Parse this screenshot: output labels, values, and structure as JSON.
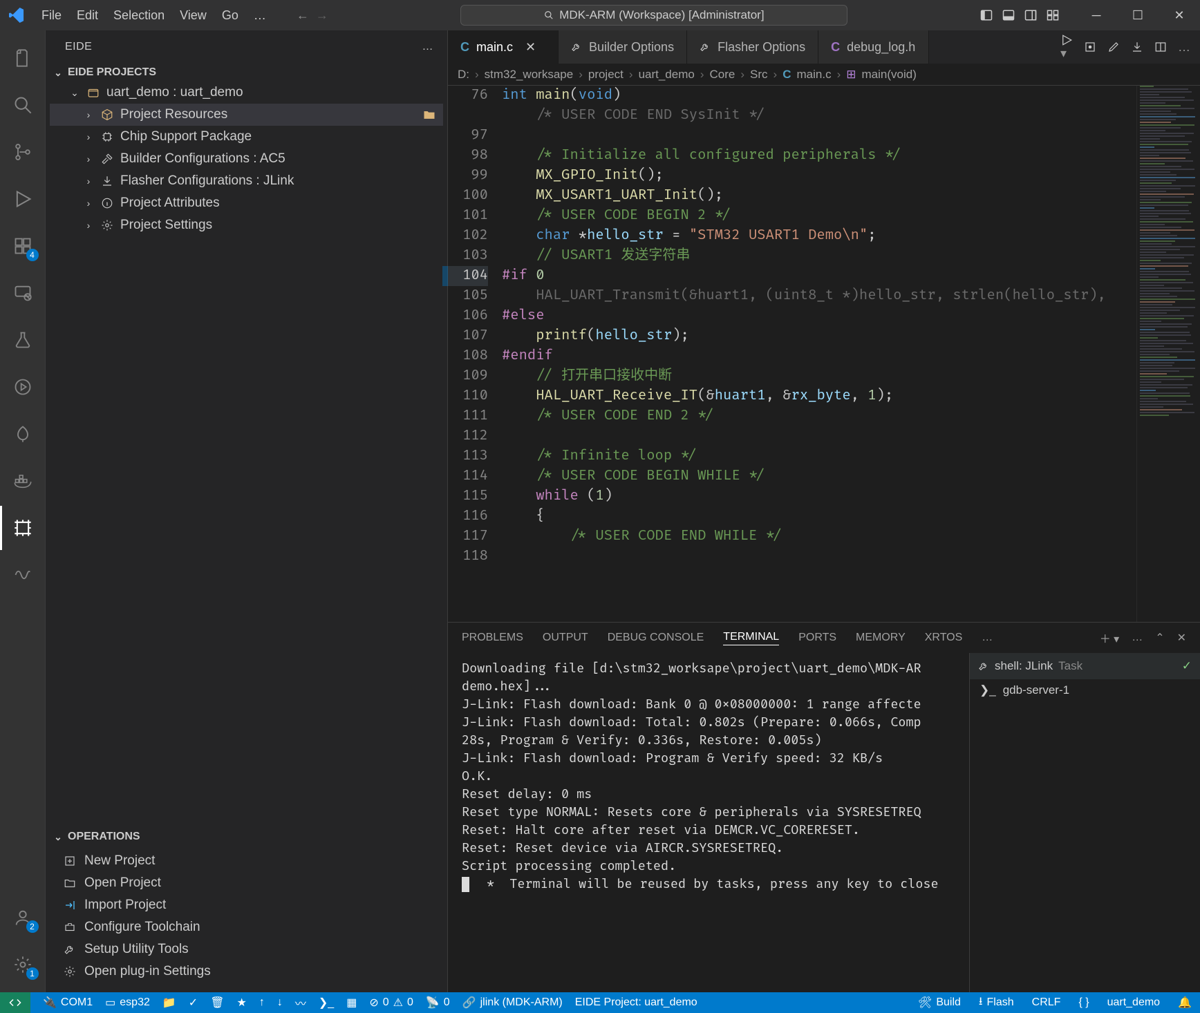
{
  "title": "MDK-ARM (Workspace) [Administrator]",
  "menu": [
    "File",
    "Edit",
    "Selection",
    "View",
    "Go",
    "…"
  ],
  "activity_badges": {
    "extensions": "4",
    "accounts": "2",
    "gear": "1"
  },
  "sidebar": {
    "title": "EIDE",
    "section": "EIDE PROJECTS",
    "project": "uart_demo : uart_demo",
    "items": [
      {
        "label": "Project Resources",
        "icon": "cube",
        "tail_icon": "folder"
      },
      {
        "label": "Chip Support Package",
        "icon": "chip"
      },
      {
        "label": "Builder Configurations : AC5",
        "icon": "hammer"
      },
      {
        "label": "Flasher Configurations : JLink",
        "icon": "download"
      },
      {
        "label": "Project Attributes",
        "icon": "info"
      },
      {
        "label": "Project Settings",
        "icon": "gear"
      }
    ],
    "operations_title": "OPERATIONS",
    "operations": [
      {
        "label": "New Project",
        "icon": "new"
      },
      {
        "label": "Open Project",
        "icon": "folder"
      },
      {
        "label": "Import Project",
        "icon": "import"
      },
      {
        "label": "Configure Toolchain",
        "icon": "tools"
      },
      {
        "label": "Setup Utility Tools",
        "icon": "wrench"
      },
      {
        "label": "Open plug-in Settings",
        "icon": "gear"
      }
    ]
  },
  "tabs": [
    {
      "label": "main.c",
      "active": true,
      "icon_color": "#519aba"
    },
    {
      "label": "Builder Options",
      "active": false,
      "icon_color": "#cccccc"
    },
    {
      "label": "Flasher Options",
      "active": false,
      "icon_color": "#cccccc"
    },
    {
      "label": "debug_log.h",
      "active": false,
      "icon_color": "#a074c4"
    }
  ],
  "breadcrumbs": [
    "D:",
    "stm32_worksape",
    "project",
    "uart_demo",
    "Core",
    "Src",
    "main.c",
    "main(void)"
  ],
  "editor": {
    "first_line": 76,
    "highlight_line": 104,
    "lines": [
      {
        "html": "<span class='kw'>int</span> <span class='fn'>main</span>(<span class='kw'>void</span>)"
      },
      {
        "html": "    <span class='dim'>/* USER CODE END SysInit */</span>"
      },
      {
        "html": ""
      },
      {
        "html": "    <span class='cm'>/* Initialize all configured peripherals */</span>"
      },
      {
        "html": "    <span class='fn'>MX_GPIO_Init</span>();"
      },
      {
        "html": "    <span class='fn'>MX_USART1_UART_Init</span>();"
      },
      {
        "html": "    <span class='cm'>/* USER CODE BEGIN 2 */</span>"
      },
      {
        "html": "    <span class='kw'>char</span> *<span class='pa'>hello_str</span> = <span class='str'>\"STM32 USART1 Demo\\n\"</span>;"
      },
      {
        "html": "    <span class='cm'>// USART1 发送字符串</span>"
      },
      {
        "html": "<span class='pp'>#if</span> <span class='num'>0</span>"
      },
      {
        "html": "    <span class='dim'>HAL_UART_Transmit(&huart1, (uint8_t *)hello_str, strlen(hello_str),</span>"
      },
      {
        "html": "<span class='pp'>#else</span>"
      },
      {
        "html": "    <span class='fn'>printf</span>(<span class='pa'>hello_str</span>);"
      },
      {
        "html": "<span class='pp'>#endif</span>"
      },
      {
        "html": "    <span class='cm'>// 打开串口接收中断</span>"
      },
      {
        "html": "    <span class='fn'>HAL_UART_Receive_IT</span>(&<span class='pa'>huart1</span>, &<span class='pa'>rx_byte</span>, <span class='num'>1</span>);"
      },
      {
        "html": "    <span class='cm'>/* USER CODE END 2 */</span>"
      },
      {
        "html": ""
      },
      {
        "html": "    <span class='cm'>/* Infinite loop */</span>"
      },
      {
        "html": "    <span class='cm'>/* USER CODE BEGIN WHILE */</span>"
      },
      {
        "html": "    <span class='pp'>while</span> (<span class='num'>1</span>)"
      },
      {
        "html": "    {"
      },
      {
        "html": "        <span class='cm'>/* USER CODE END WHILE */</span>"
      },
      {
        "html": ""
      }
    ]
  },
  "panel": {
    "tabs": [
      "PROBLEMS",
      "OUTPUT",
      "DEBUG CONSOLE",
      "TERMINAL",
      "PORTS",
      "MEMORY",
      "XRTOS",
      "…"
    ],
    "active": "TERMINAL",
    "terminal_lines": [
      "Downloading file [d:\\stm32_worksape\\project\\uart_demo\\MDK-AR",
      "demo.hex]...",
      "J-Link: Flash download: Bank 0 @ 0x08000000: 1 range affecte",
      "J-Link: Flash download: Total: 0.802s (Prepare: 0.066s, Comp",
      "28s, Program & Verify: 0.336s, Restore: 0.005s)",
      "J-Link: Flash download: Program & Verify speed: 32 KB/s",
      "O.K.",
      "",
      "Reset delay: 0 ms",
      "Reset type NORMAL: Resets core & peripherals via SYSRESETREQ",
      "Reset: Halt core after reset via DEMCR.VC_CORERESET.",
      "Reset: Reset device via AIRCR.SYSRESETREQ.",
      "",
      "",
      "",
      "Script processing completed.",
      ""
    ],
    "terminal_hint": "Terminal will be reused by tasks, press any key to close",
    "task_group": {
      "label": "shell: JLink",
      "badge": "Task"
    },
    "tasks": [
      {
        "label": "gdb-server-1"
      }
    ]
  },
  "status": {
    "remote": "><",
    "com": "COM1",
    "board": "esp32",
    "errors": "0",
    "warnings": "0",
    "radio": "0",
    "link": "jlink (MDK-ARM)",
    "project": "EIDE Project: uart_demo",
    "build": "Build",
    "flash": "Flash",
    "eol": "CRLF",
    "lang": "{ }",
    "target": "uart_demo"
  }
}
